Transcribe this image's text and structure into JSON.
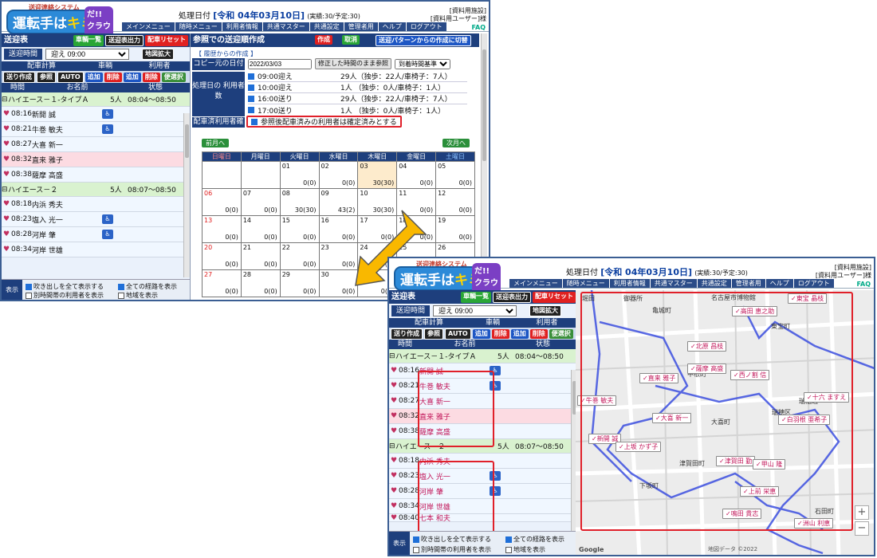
{
  "logo": {
    "sub": "送迎連絡システム",
    "main": "運転手は",
    "kimi": "キミ",
    "cloud": "だ!! クラウド"
  },
  "header": {
    "date_label": "処理日付",
    "date_value": "[令和 04年03月10日]",
    "date_note": "(実績:30/予定:30)",
    "facility": "[資料用施設]",
    "user": "[資料用ユーザー]様"
  },
  "menu": [
    "メインメニュー",
    "随時メニュー",
    "利用者情報",
    "共通マスター",
    "共通設定",
    "管理者用",
    "ヘルプ",
    "ログアウト"
  ],
  "faq": "FAQ",
  "left": {
    "title": "送迎表",
    "btn_vehicles": "車輌一覧",
    "btn_print": "送迎表出力",
    "btn_reset": "配車リセット",
    "time_label": "送迎時間",
    "time_value": "迎え 09:00",
    "btn_map": "地図拡大",
    "group_headers": [
      "配車計算",
      "車輌",
      "利用者"
    ],
    "tools": [
      "送り作成",
      "参照",
      "AUTO",
      "追加",
      "削除",
      "追加",
      "削除",
      "便選択"
    ],
    "cols": [
      "時間",
      "お名前",
      "状態"
    ],
    "groups": [
      {
        "name": "ハイエース－１-タイプＡ",
        "count": "5人",
        "range": "08:04～08:50",
        "rows": [
          {
            "t": "08:16",
            "n": "新開 誠",
            "i": "♿"
          },
          {
            "t": "08:21",
            "n": "牛巻 敏夫",
            "i": "♿"
          },
          {
            "t": "08:27",
            "n": "大喜 新一",
            "i": ""
          },
          {
            "t": "08:32",
            "n": "直来 雅子",
            "i": ""
          },
          {
            "t": "08:38",
            "n": "薩摩 高盛",
            "i": ""
          }
        ]
      },
      {
        "name": "ハイエース－２",
        "count": "5人",
        "range": "08:07～08:50",
        "rows": [
          {
            "t": "08:18",
            "n": "内浜 秀夫",
            "i": ""
          },
          {
            "t": "08:23",
            "n": "塩入 光一",
            "i": "♿"
          },
          {
            "t": "08:28",
            "n": "河岸 肇",
            "i": "♿"
          },
          {
            "t": "08:34",
            "n": "河岸 世雄",
            "i": ""
          },
          {
            "t": "08:40",
            "n": "七本 和夫",
            "i": ""
          }
        ]
      }
    ],
    "disp": "表示",
    "opt1": "吹き出しを全て表示する",
    "opt2": "全ての経路を表示",
    "opt3": "別時間帯の利用者を表示",
    "opt4": "地域を表示"
  },
  "create": {
    "title": "参照での送迎順作成",
    "btn_create": "作成",
    "btn_cancel": "取消",
    "btn_pattern": "送迎パターンからの作成に切替",
    "tab": "【 履歴からの作成 】",
    "copy_label": "コピー元の日付",
    "copy_date": "2022/03/03",
    "btn_keep": "修正した時間のまま参照",
    "base": "到着時間基準",
    "counts_label": "処理日の 利用者数",
    "counts": [
      {
        "t": "09:00迎え",
        "v": "29人（独歩：22人/車椅子：7人）"
      },
      {
        "t": "10:00迎え",
        "v": "1人 （独歩：0人/車椅子：1人）"
      },
      {
        "t": "16:00送り",
        "v": "29人（独歩：22人/車椅子：7人）"
      },
      {
        "t": "17:00送り",
        "v": "1人 （独歩：0人/車椅子：1人）"
      }
    ],
    "confirm_label": "配車済利用者確定",
    "confirm_text": "参照後配車済みの利用者は確定済みとする",
    "prev": "前月へ",
    "next": "次月へ",
    "weekdays": [
      "日曜日",
      "月曜日",
      "火曜日",
      "水曜日",
      "木曜日",
      "金曜日",
      "土曜日"
    ],
    "weeks": [
      [
        [
          "",
          ""
        ],
        [
          "",
          ""
        ],
        [
          "01",
          "0(0)"
        ],
        [
          "02",
          "0(0)"
        ],
        [
          "03",
          "30(30)"
        ],
        [
          "04",
          "0(0)"
        ],
        [
          "05",
          "0(0)"
        ]
      ],
      [
        [
          "06",
          "0(0)"
        ],
        [
          "07",
          "0(0)"
        ],
        [
          "08",
          "30(30)"
        ],
        [
          "09",
          "43(2)"
        ],
        [
          "10",
          "30(30)"
        ],
        [
          "11",
          "0(0)"
        ],
        [
          "12",
          "0(0)"
        ]
      ],
      [
        [
          "13",
          "0(0)"
        ],
        [
          "14",
          "0(0)"
        ],
        [
          "15",
          "0(0)"
        ],
        [
          "16",
          "0(0)"
        ],
        [
          "17",
          "0(0)"
        ],
        [
          "18",
          "0(0)"
        ],
        [
          "19",
          "0(0)"
        ]
      ],
      [
        [
          "20",
          "0(0)"
        ],
        [
          "21",
          "0(0)"
        ],
        [
          "22",
          "0(0)"
        ],
        [
          "23",
          "0(0)"
        ],
        [
          "24",
          "0(0)"
        ],
        [
          "25",
          "0(0)"
        ],
        [
          "26",
          "0(0)"
        ]
      ],
      [
        [
          "27",
          "0(0)"
        ],
        [
          "28",
          "0(0)"
        ],
        [
          "29",
          "0(0)"
        ],
        [
          "30",
          "0(0)"
        ],
        [
          "31",
          "0(0)"
        ],
        [
          "",
          ""
        ],
        [
          "",
          ""
        ]
      ]
    ]
  },
  "map": {
    "tags": [
      "✓東宝 晶枝",
      "✓高田 恵之助",
      "✓北原 昌枝",
      "✓薩摩 高盛",
      "✓西ノ割 信",
      "✓直来 雅子",
      "✓牛巻 敏夫",
      "✓十六 ますえ",
      "✓大喜 新一",
      "✓白羽根 亜希子",
      "✓新開 誠",
      "✓上坂 かず子",
      "✓津賀田 勤",
      "✓甲山 隆",
      "✓上前 栄恵",
      "✓鳴田 貴志",
      "✓洲山 利恵"
    ],
    "places": [
      "堀田",
      "御器所",
      "名古屋市博物館",
      "東宝町",
      "亀城町",
      "雁道町",
      "瑞穂区",
      "石田町",
      "陽明町",
      "下坂町",
      "津賀田町",
      "中根町",
      "大喜町",
      "瑞穂通",
      "甲山町"
    ],
    "credit": "Google",
    "copyright": "地図データ ©2022"
  }
}
